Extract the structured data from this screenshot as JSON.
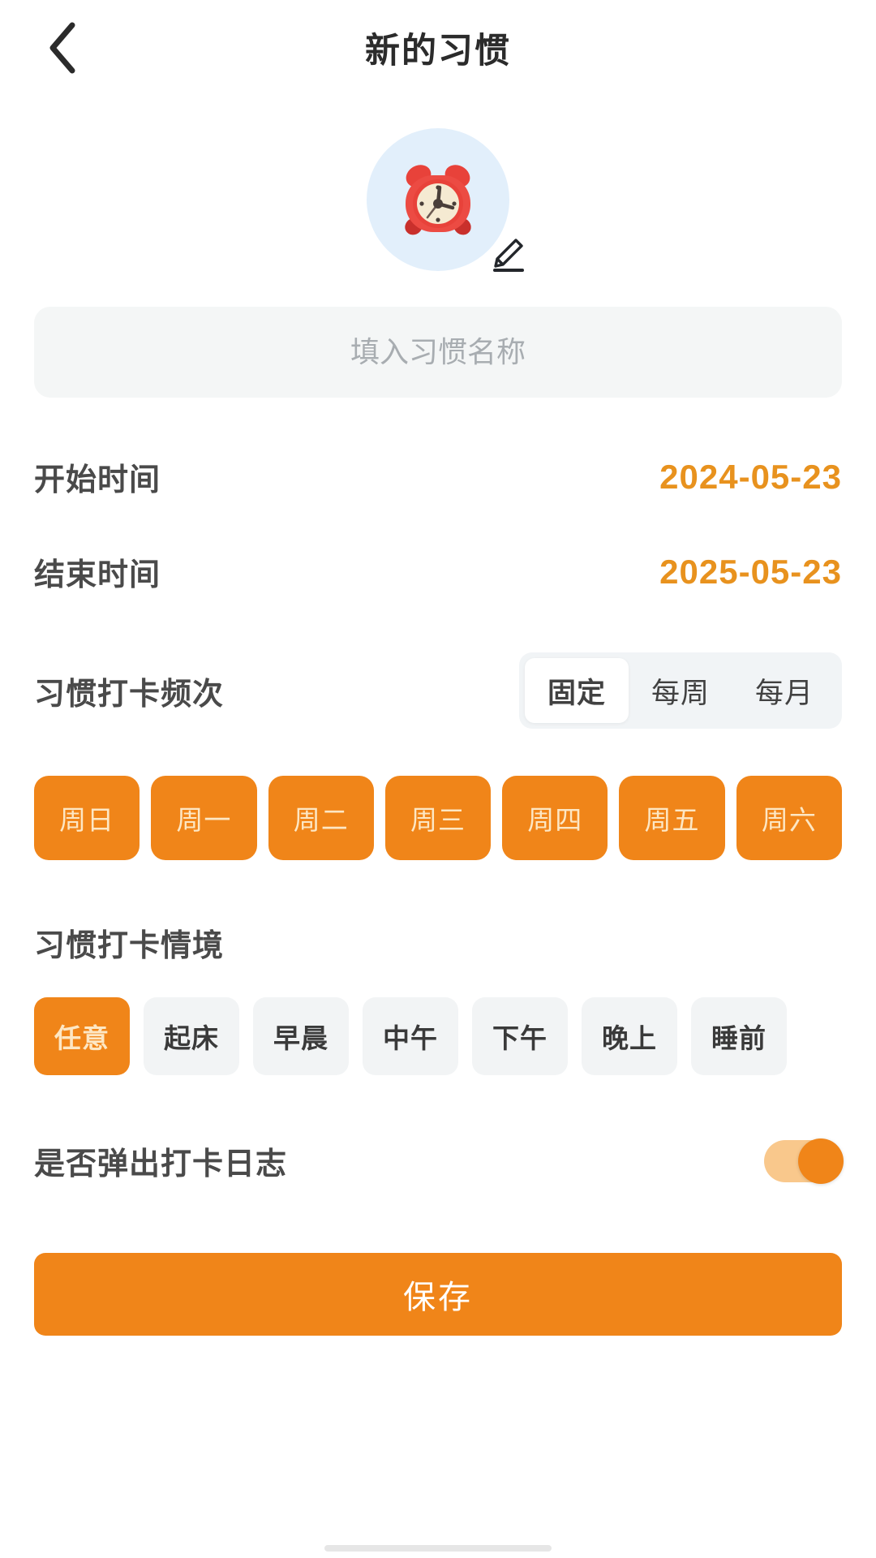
{
  "header": {
    "back_icon": "chevron-left-icon",
    "title": "新的习惯"
  },
  "avatar": {
    "icon": "alarm-clock-icon",
    "edit_icon": "pencil-icon",
    "circle_color": "#e2effb"
  },
  "name_input": {
    "placeholder": "填入习惯名称",
    "value": ""
  },
  "start_date": {
    "label": "开始时间",
    "value": "2024-05-23"
  },
  "end_date": {
    "label": "结束时间",
    "value": "2025-05-23"
  },
  "frequency": {
    "label": "习惯打卡频次",
    "options": [
      "固定",
      "每周",
      "每月"
    ],
    "selected": "固定"
  },
  "weekdays": {
    "items": [
      "周日",
      "周一",
      "周二",
      "周三",
      "周四",
      "周五",
      "周六"
    ],
    "selected": [
      "周日",
      "周一",
      "周二",
      "周三",
      "周四",
      "周五",
      "周六"
    ]
  },
  "context": {
    "label": "习惯打卡情境",
    "items": [
      "任意",
      "起床",
      "早晨",
      "中午",
      "下午",
      "晚上",
      "睡前"
    ],
    "selected": "任意"
  },
  "log_toggle": {
    "label": "是否弹出打卡日志",
    "state": "on"
  },
  "save": {
    "label": "保存"
  },
  "colors": {
    "accent": "#f08519",
    "date_text": "#e8921e",
    "chip_text": "#fde7c4",
    "field_bg": "#f4f6f6"
  }
}
